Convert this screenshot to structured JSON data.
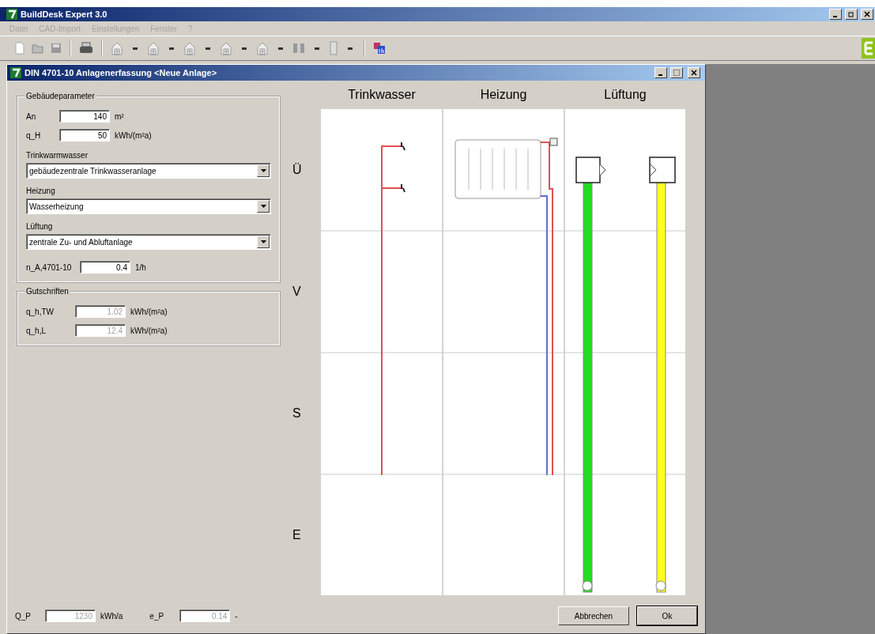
{
  "app": {
    "title": "BuildDesk Expert 3.0"
  },
  "menu": [
    {
      "label": "Datei",
      "disabled": true
    },
    {
      "label": "CAD-Import",
      "disabled": true
    },
    {
      "label": "Einstellungen",
      "disabled": true
    },
    {
      "label": "Fenster",
      "disabled": true
    },
    {
      "label": "?",
      "disabled": true
    }
  ],
  "dialog": {
    "title": "DIN 4701-10 Anlagenerfassung <Neue Anlage>",
    "building_parameters": {
      "title": "Gebäudeparameter",
      "fields": [
        {
          "label": "An",
          "value": "140",
          "unit": "m²",
          "disabled": false
        },
        {
          "label": "q_H",
          "value": "50",
          "unit": "kWh/(m²a)",
          "disabled": false
        }
      ],
      "selects": [
        {
          "label": "Trinkwarmwasser",
          "value": "gebäudezentrale Trinkwasseranlage"
        },
        {
          "label": "Heizung",
          "value": "Wasserheizung"
        },
        {
          "label": "Lüftung",
          "value": "zentrale Zu- und Abluftanlage"
        }
      ],
      "air_change": {
        "label": "n_A,4701-10",
        "value": "0.4",
        "unit": "1/h",
        "disabled": false
      }
    },
    "credits": {
      "title": "Gutschriften",
      "fields": [
        {
          "label": "q_h,TW",
          "value": "1.02",
          "unit": "kWh/(m²a)",
          "disabled": true
        },
        {
          "label": "q_h,L",
          "value": "12.4",
          "unit": "kWh/(m²a)",
          "disabled": true
        }
      ]
    },
    "diagram": {
      "columns": [
        "Trinkwasser",
        "Heizung",
        "Lüftung"
      ],
      "rows": [
        "Ü",
        "V",
        "S",
        "E"
      ]
    },
    "footer": {
      "fields": [
        {
          "label": "Q_P",
          "value": "1230",
          "unit": "kWh/a",
          "disabled": true
        },
        {
          "label": "e_P",
          "value": "0.14",
          "unit": "-",
          "disabled": true
        }
      ]
    },
    "buttons": [
      {
        "label": "Abbrechen",
        "default": false
      },
      {
        "label": "Ok",
        "default": true
      }
    ]
  }
}
